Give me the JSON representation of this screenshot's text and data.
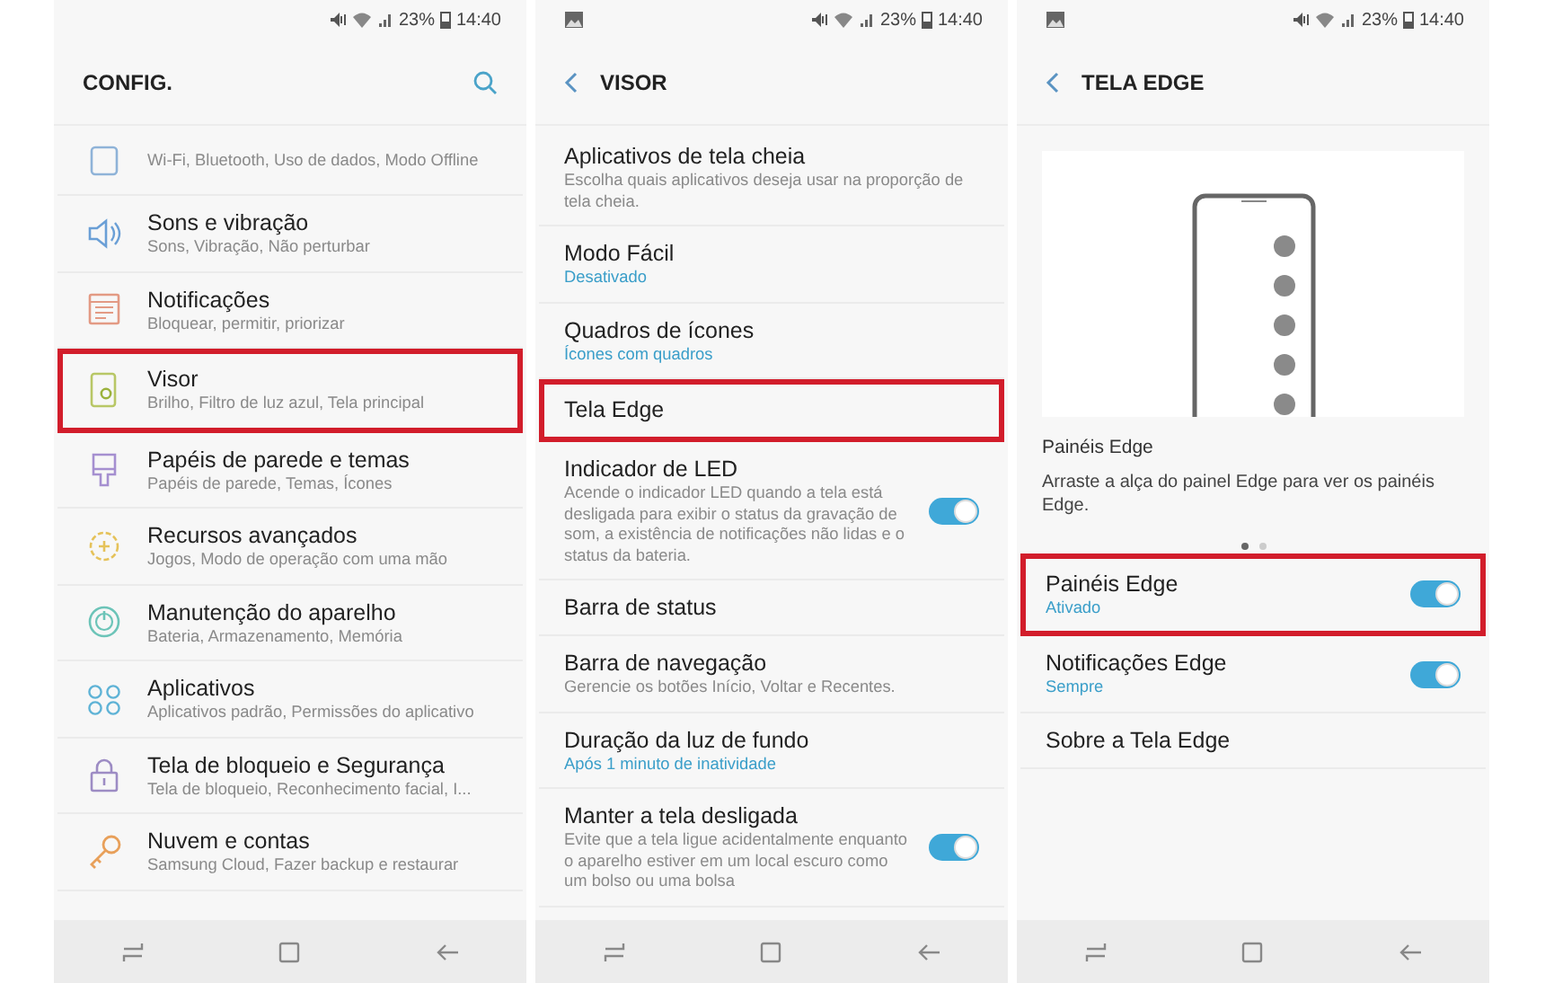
{
  "screens": [
    {
      "status_bar": {
        "notification_icon": false,
        "battery": "23%",
        "time": "14:40"
      },
      "header": {
        "title": "CONFIG.",
        "back": false,
        "search": true
      },
      "items": [
        {
          "description": "Wi-Fi, Bluetooth, Uso de dados, Modo Offline",
          "highlighted": false
        },
        {
          "title": "Sons e vibração",
          "description": "Sons, Vibração, Não perturbar",
          "highlighted": false
        },
        {
          "title": "Notificações",
          "description": "Bloquear, permitir, priorizar",
          "highlighted": false
        },
        {
          "title": "Visor",
          "description": "Brilho, Filtro de luz azul, Tela principal",
          "highlighted": true
        },
        {
          "title": "Papéis de parede e temas",
          "description": "Papéis de parede, Temas, Ícones",
          "highlighted": false
        },
        {
          "title": "Recursos avançados",
          "description": "Jogos, Modo de operação com uma mão",
          "highlighted": false
        },
        {
          "title": "Manutenção do aparelho",
          "description": "Bateria, Armazenamento, Memória",
          "highlighted": false
        },
        {
          "title": "Aplicativos",
          "description": "Aplicativos padrão, Permissões do aplicativo",
          "highlighted": false
        },
        {
          "title": "Tela de bloqueio e Segurança",
          "description": "Tela de bloqueio, Reconhecimento facial, I...",
          "highlighted": false
        },
        {
          "title": "Nuvem e contas",
          "description": "Samsung Cloud, Fazer backup e restaurar",
          "highlighted": false
        }
      ]
    },
    {
      "status_bar": {
        "notification_icon": true,
        "battery": "23%",
        "time": "14:40"
      },
      "header": {
        "title": "VISOR",
        "back": true,
        "search": false
      },
      "items": [
        {
          "title": "Aplicativos de tela cheia",
          "description": "Escolha quais aplicativos deseja usar na proporção de tela cheia.",
          "highlighted": false
        },
        {
          "title": "Modo Fácil",
          "value": "Desativado",
          "highlighted": false
        },
        {
          "title": "Quadros de ícones",
          "value": "Ícones com quadros",
          "highlighted": false
        },
        {
          "title": "Tela Edge",
          "highlighted": true
        },
        {
          "title": "Indicador de LED",
          "description": "Acende o indicador LED quando a tela está desligada para exibir o status da gravação de som, a existência de notificações não lidas e o status da bateria.",
          "on": true,
          "highlighted": false
        },
        {
          "title": "Barra de status",
          "highlighted": false
        },
        {
          "title": "Barra de navegação",
          "description": "Gerencie os botões Início, Voltar e Recentes.",
          "highlighted": false
        },
        {
          "title": "Duração da luz de fundo",
          "value": "Após 1 minuto de inatividade",
          "highlighted": false
        },
        {
          "title": "Manter a tela desligada",
          "description": "Evite que a tela ligue acidentalmente enquanto o aparelho estiver em um local escuro como um bolso ou uma bolsa",
          "on": true,
          "highlighted": false
        }
      ]
    },
    {
      "status_bar": {
        "notification_icon": true,
        "battery": "23%",
        "time": "14:40"
      },
      "header": {
        "title": "TELA EDGE",
        "back": true,
        "search": false
      },
      "carousel": {
        "title": "Painéis Edge",
        "text": "Arraste a alça do painel Edge para ver os painéis Edge.",
        "pages": [
          {
            "selected": true
          },
          {
            "selected": false
          }
        ]
      },
      "items": [
        {
          "title": "Painéis Edge",
          "value": "Ativado",
          "on": true,
          "highlighted": true
        },
        {
          "title": "Notificações Edge",
          "value": "Sempre",
          "on": true,
          "highlighted": false
        },
        {
          "title": "Sobre a Tela Edge",
          "highlighted": false
        }
      ]
    }
  ]
}
